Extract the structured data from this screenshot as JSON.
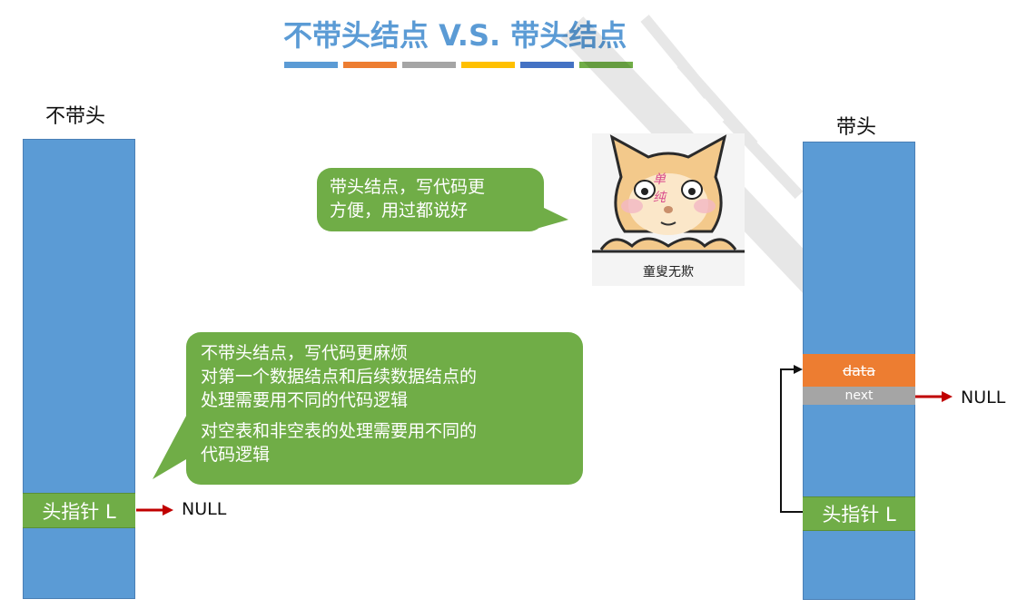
{
  "title": "不带头结点 V.S. 带头结点",
  "title_bar_colors": [
    "#5B9BD5",
    "#ED7D31",
    "#A5A5A5",
    "#FFC000",
    "#4472C4",
    "#70AD47"
  ],
  "left": {
    "label": "不带头",
    "head_pointer": "头指针 L",
    "null_label": "NULL"
  },
  "right": {
    "label": "带头",
    "data_label": "data",
    "next_label": "next",
    "head_pointer": "头指针 L",
    "null_label": "NULL"
  },
  "bubble_top": {
    "lines": [
      "带头结点，写代码更",
      "方便，用过都说好"
    ]
  },
  "bubble_bottom": {
    "lines": [
      "不带头结点，写代码更麻烦",
      "对第一个数据结点和后续数据结点的",
      "处理需要用不同的代码逻辑",
      "对空表和非空表的处理需要用不同的",
      "代码逻辑"
    ]
  },
  "emoji": {
    "caption": "童叟无欺",
    "face_text": "单纯"
  },
  "colors": {
    "blue": "#5B9BD5",
    "green": "#70AD47",
    "orange": "#ED7D31",
    "gray": "#A5A5A5",
    "arrow": "#C00000"
  }
}
